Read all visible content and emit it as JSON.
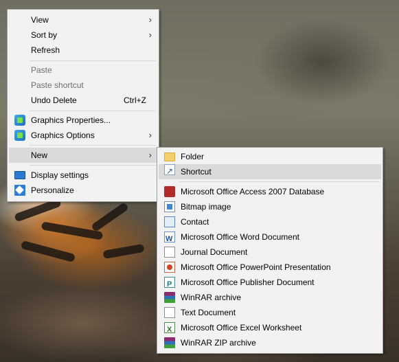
{
  "context_menu": {
    "items": [
      {
        "label": "View",
        "has_submenu": true
      },
      {
        "label": "Sort by",
        "has_submenu": true
      },
      {
        "label": "Refresh"
      },
      {
        "label": "Paste",
        "disabled": true
      },
      {
        "label": "Paste shortcut",
        "disabled": true
      },
      {
        "label": "Undo Delete",
        "shortcut": "Ctrl+Z"
      },
      {
        "label": "Graphics Properties...",
        "icon": "graphics-icon"
      },
      {
        "label": "Graphics Options",
        "icon": "graphics-icon",
        "has_submenu": true
      },
      {
        "label": "New",
        "has_submenu": true,
        "active": true
      },
      {
        "label": "Display settings",
        "icon": "display-icon"
      },
      {
        "label": "Personalize",
        "icon": "personalize-icon"
      }
    ],
    "submenu_arrow": "›"
  },
  "new_submenu": {
    "items": [
      {
        "label": "Folder",
        "icon": "folder-icon"
      },
      {
        "label": "Shortcut",
        "icon": "shortcut-icon",
        "highlighted": true
      },
      {
        "label": "Microsoft Office Access 2007 Database",
        "icon": "access-icon"
      },
      {
        "label": "Bitmap image",
        "icon": "bitmap-icon"
      },
      {
        "label": "Contact",
        "icon": "contact-icon"
      },
      {
        "label": "Microsoft Office Word Document",
        "icon": "word-icon"
      },
      {
        "label": "Journal Document",
        "icon": "journal-icon"
      },
      {
        "label": "Microsoft Office PowerPoint Presentation",
        "icon": "powerpoint-icon"
      },
      {
        "label": "Microsoft Office Publisher Document",
        "icon": "publisher-icon"
      },
      {
        "label": "WinRAR archive",
        "icon": "winrar-icon"
      },
      {
        "label": "Text Document",
        "icon": "text-document-icon"
      },
      {
        "label": "Microsoft Office Excel Worksheet",
        "icon": "excel-icon"
      },
      {
        "label": "WinRAR ZIP archive",
        "icon": "winrar-zip-icon"
      }
    ]
  }
}
